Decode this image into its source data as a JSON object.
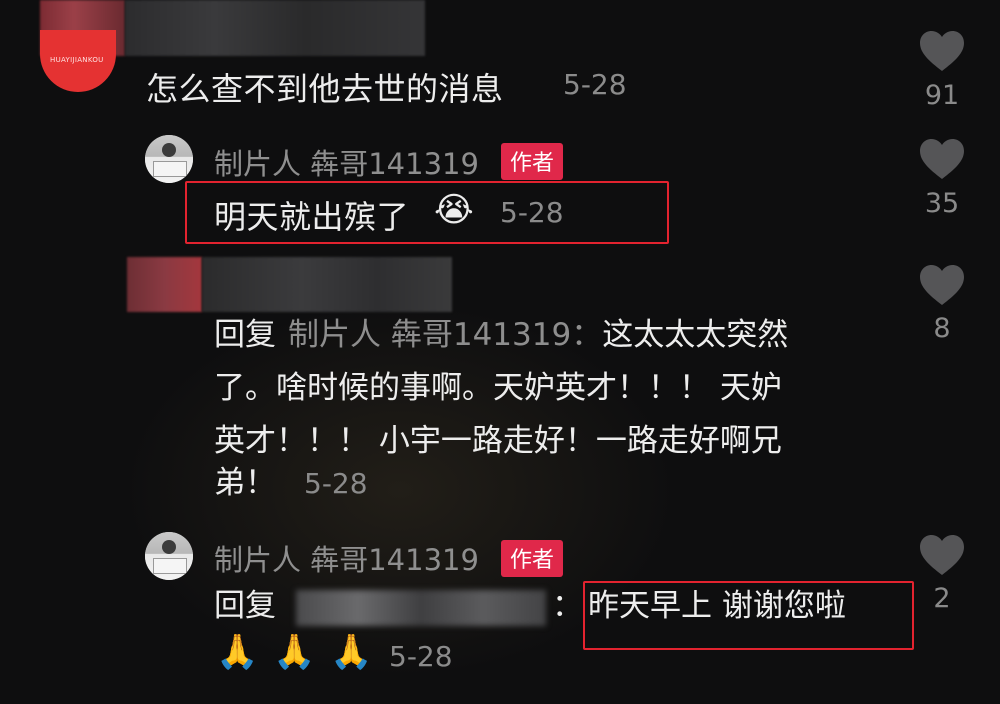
{
  "comments": [
    {
      "text": "怎么查不到他去世的消息",
      "time": "5-28",
      "likes": "91",
      "avatar_text": "HUAYIJIANKOU"
    },
    {
      "username": "制片人 犇哥141319",
      "badge": "作者",
      "text": "明天就出殡了",
      "emoji": "😭",
      "time": "5-28",
      "likes": "35"
    },
    {
      "reply_prefix": "回复",
      "reply_target": "制片人 犇哥141319：",
      "line1": "这太太太突然",
      "line2": "了。啥时候的事啊。天妒英才！！！ 天妒",
      "line3": "英才！！！ 小宇一路走好！一路走好啊兄",
      "line4": "弟！",
      "time": "5-28",
      "likes": "8"
    },
    {
      "username": "制片人 犇哥141319",
      "badge": "作者",
      "reply_prefix": "回复",
      "colon": "：",
      "text": "昨天早上 谢谢您啦",
      "emojis": "🙏 🙏 🙏",
      "time": "5-28",
      "likes": "2"
    }
  ],
  "colors": {
    "background": "#0e0e0f",
    "author_badge": "#e0284a",
    "highlight_box": "#e3232f",
    "secondary_text": "#8b8b8b"
  },
  "icons": [
    "heart-icon",
    "avatar"
  ]
}
